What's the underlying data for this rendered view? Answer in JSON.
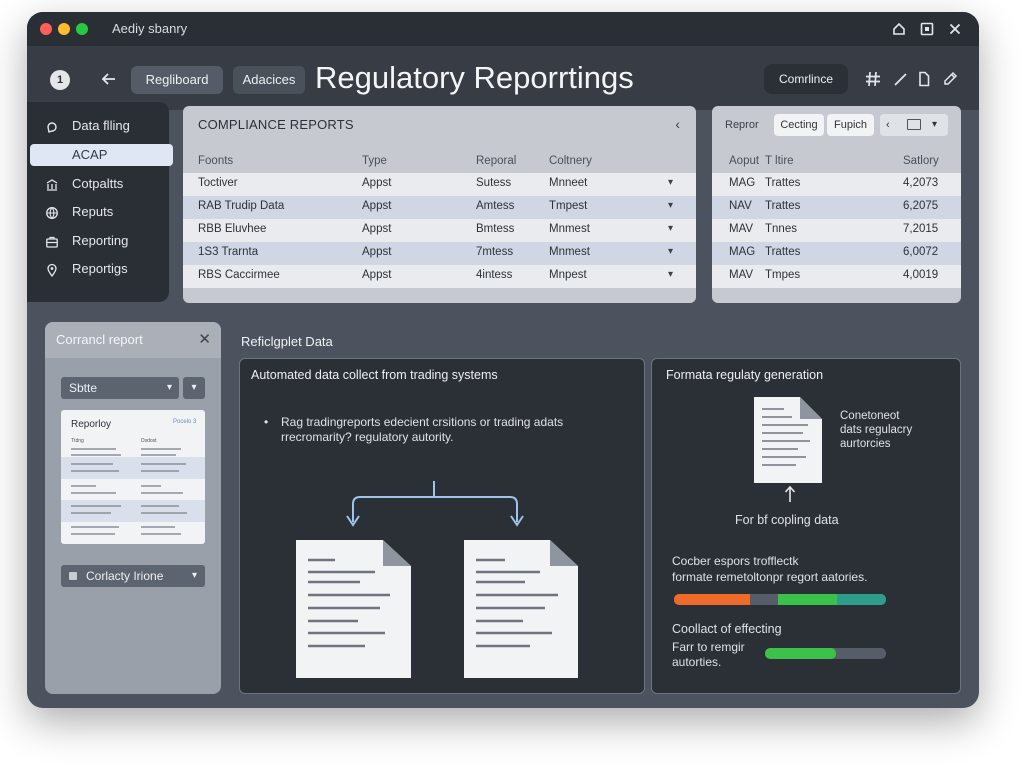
{
  "app_title": "Aediy sbanry",
  "header": {
    "step": "1",
    "pill_1": "Regliboard",
    "pill_2": "Adacices",
    "page_title": "Regulatory Reporrtings",
    "compliance_button": "Comrlince"
  },
  "sidebar": {
    "items": [
      {
        "label": "Data flling",
        "icon": "data-icon"
      },
      {
        "label": "ACAP",
        "icon": "none"
      },
      {
        "label": "Cotpaltts",
        "icon": "library-icon"
      },
      {
        "label": "Reputs",
        "icon": "globe-icon"
      },
      {
        "label": "Reporting",
        "icon": "briefcase-icon"
      },
      {
        "label": "Reportigs",
        "icon": "location-pin-icon"
      }
    ]
  },
  "compliance_reports": {
    "title": "COMPLIANCE REPORTS",
    "columns": [
      "Foonts",
      "Type",
      "Reporal",
      "Coltnery"
    ],
    "rows": [
      [
        "Toctiver",
        "Appst",
        "Sutess",
        "Mnneet"
      ],
      [
        "RAB Trudip Data",
        "Appst",
        "Amtess",
        "Tmpest"
      ],
      [
        "RBB Eluvhee",
        "Appst",
        "Bmtess",
        "Mnmest"
      ],
      [
        "1S3 Trarnta",
        "Appst",
        "7mtess",
        "Mnmest"
      ],
      [
        "RBS Caccirmee",
        "Appst",
        "4intess",
        "Mnpest"
      ]
    ]
  },
  "right_table": {
    "label": "Repror",
    "button_1": "Cecting",
    "button_2": "Fupich",
    "columns": [
      "Aoput",
      "T ltire",
      "Satlory"
    ],
    "rows": [
      [
        "MAG",
        "Trattes",
        "4,2073"
      ],
      [
        "NAV",
        "Trattes",
        "6,2075"
      ],
      [
        "MAV",
        "Tnnes",
        "7,2015"
      ],
      [
        "MAG",
        "Trattes",
        "6,0072"
      ],
      [
        "MAV",
        "Tmpes",
        "4,0019"
      ]
    ]
  },
  "current_report": {
    "title": "Corrancl report",
    "select_1": "Sbtte",
    "doc_title": "Reporloy",
    "doc_link": "Pocelo 3",
    "doc_col_1": "Ttdng",
    "doc_col_2": "Dsdost",
    "select_2": "Corlacty Irione"
  },
  "section_title": "Reficlgplet Data",
  "card_left": {
    "title": "Automated data collect from trading systems",
    "bullet_line_1": "Rag tradingreports edecient crsitions or trading adats",
    "bullet_line_2": "rrecromarity? regulatory autority."
  },
  "card_right": {
    "title": "Formata regulaty generation",
    "doc_note_1": "Conetoneot",
    "doc_note_2": "dats regulacry",
    "doc_note_3": "aurtorcies",
    "caption": "For bf copling data",
    "note_1": "Cocber espors trofflectk",
    "note_2": "formate remetoltonpr regort aatories.",
    "progress_1": {
      "orange": 0.36,
      "gray": 0.13,
      "green": 0.28,
      "teal": 0.23
    },
    "label_2": "Coollact of effecting",
    "label_3": "Farr to remgir",
    "label_4": "autorties.",
    "progress_2": 0.59
  },
  "colors": {
    "orange": "#ee6b2b",
    "green": "#3cc24a",
    "teal": "#2e9d8a",
    "track": "#565d68"
  }
}
